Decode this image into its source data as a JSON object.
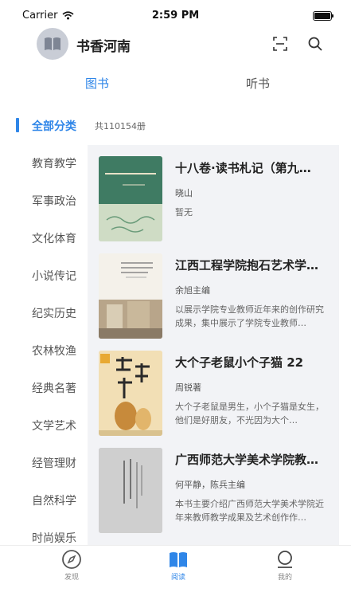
{
  "status_bar": {
    "carrier": "Carrier",
    "time": "2:59 PM"
  },
  "header": {
    "title": "书香河南"
  },
  "tabs": [
    {
      "label": "图书"
    },
    {
      "label": "听书"
    }
  ],
  "sidebar": {
    "items": [
      {
        "label": "全部分类"
      },
      {
        "label": "教育教学"
      },
      {
        "label": "军事政治"
      },
      {
        "label": "文化体育"
      },
      {
        "label": "小说传记"
      },
      {
        "label": "纪实历史"
      },
      {
        "label": "农林牧渔"
      },
      {
        "label": "经典名著"
      },
      {
        "label": "文学艺术"
      },
      {
        "label": "经管理财"
      },
      {
        "label": "自然科学"
      },
      {
        "label": "时尚娱乐"
      }
    ]
  },
  "count": "共110154册",
  "books": [
    {
      "title": "十八卷·读书札记（第九…",
      "author": "晓山",
      "desc": "暂无",
      "cover_color": "#cfdcc5"
    },
    {
      "title": "江西工程学院抱石艺术学…",
      "author": "余旭主编",
      "desc": "以展示学院专业教师近年来的创作研究成果，集中展示了学院专业教师…",
      "cover_color": "#f4f1ea"
    },
    {
      "title": "大个子老鼠小个子猫 22",
      "author": "周锐著",
      "desc": "大个子老鼠是男生，小个子猫是女生，他们是好朋友，不光因为大个…",
      "cover_color": "#f2dfb5"
    },
    {
      "title": "广西师范大学美术学院教…",
      "author": "何平静，陈兵主编",
      "desc": "本书主要介绍广西师范大学美术学院近年来教师教学成果及艺术创作作…",
      "cover_color": "#cfcfcf"
    }
  ],
  "tabbar": [
    {
      "label": "发现"
    },
    {
      "label": "阅读"
    },
    {
      "label": "我的"
    }
  ],
  "colors": {
    "accent": "#2f86e8"
  }
}
